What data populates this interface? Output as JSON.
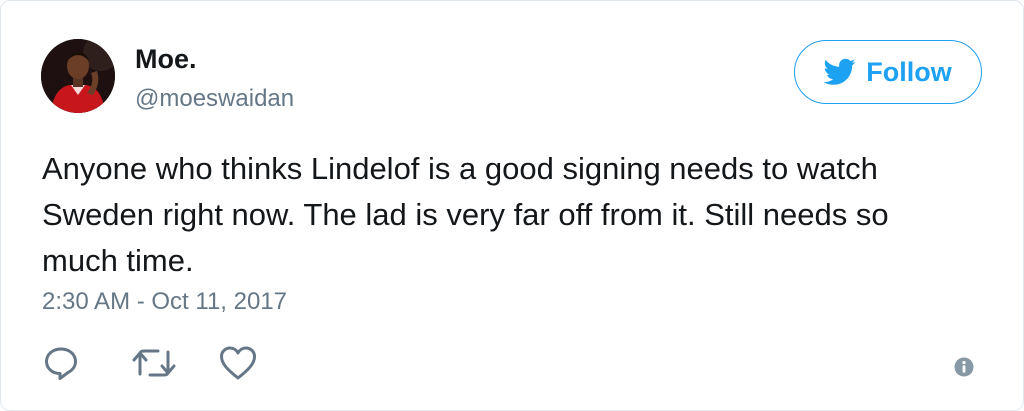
{
  "user": {
    "display_name": "Moe.",
    "handle": "@moeswaidan",
    "avatar_icon": "user-avatar"
  },
  "follow_button": {
    "label": "Follow",
    "icon": "twitter-bird-icon",
    "color": "#1da1f2"
  },
  "tweet": {
    "text": "Anyone who thinks Lindelof is a good signing needs to watch Sweden right now. The lad is very far off from it. Still needs so much time.",
    "timestamp": "2:30 AM - Oct 11, 2017"
  },
  "actions": [
    {
      "icon": "reply-icon"
    },
    {
      "icon": "retweet-icon"
    },
    {
      "icon": "like-icon"
    },
    {
      "icon": "info-icon"
    }
  ],
  "colors": {
    "text_primary": "#14171a",
    "text_secondary": "#657786",
    "accent": "#1da1f2",
    "border": "#e1e8ed"
  }
}
